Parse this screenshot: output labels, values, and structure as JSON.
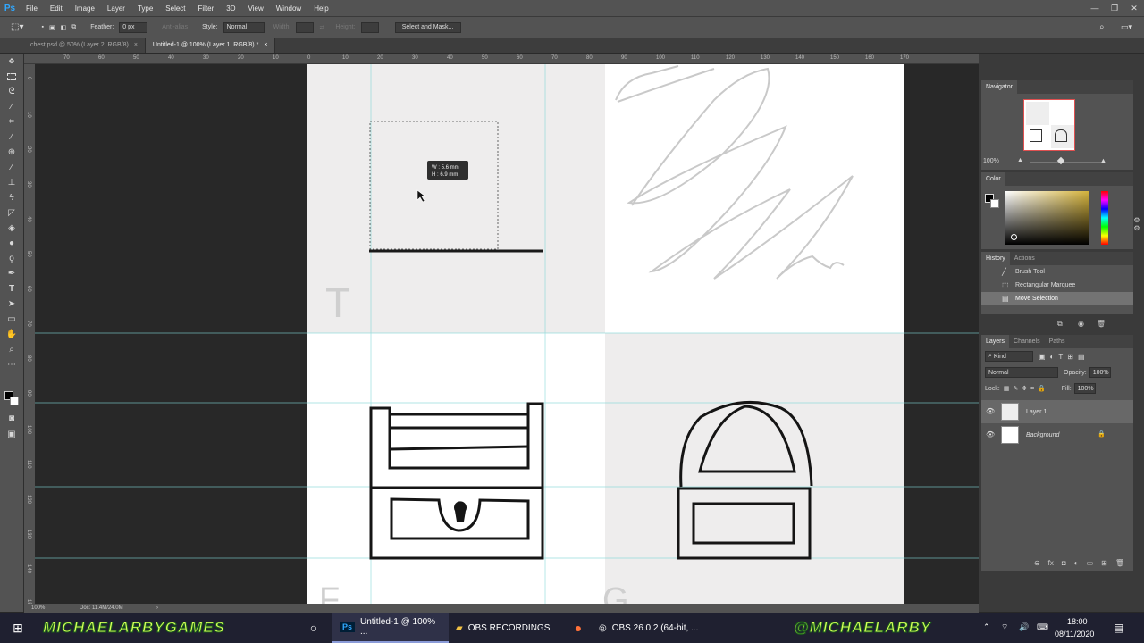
{
  "app": {
    "logo": "Ps",
    "window_controls": [
      "—",
      "❐",
      "✕"
    ]
  },
  "menu": [
    "File",
    "Edit",
    "Image",
    "Layer",
    "Type",
    "Select",
    "Filter",
    "3D",
    "View",
    "Window",
    "Help"
  ],
  "options": {
    "feather_label": "Feather:",
    "feather_value": "0 px",
    "antialias_label": "Anti-alias",
    "style_label": "Style:",
    "style_value": "Normal",
    "width_label": "Width:",
    "height_label": "Height:",
    "select_mask_label": "Select and Mask..."
  },
  "doc_tabs": [
    {
      "label": "chest.psd @ 50% (Layer 2, RGB/8)"
    },
    {
      "label": "Untitled-1 @ 100% (Layer 1, RGB/8) *"
    }
  ],
  "ruler_top": [
    "70",
    "60",
    "50",
    "40",
    "30",
    "20",
    "10",
    "0",
    "10",
    "20",
    "30",
    "40",
    "50",
    "60",
    "70",
    "80",
    "90",
    "100",
    "110",
    "120",
    "130",
    "140",
    "150",
    "160",
    "170"
  ],
  "ruler_left": [
    "0",
    "10",
    "20",
    "30",
    "40",
    "50",
    "60",
    "70",
    "80",
    "90",
    "100",
    "110",
    "120",
    "130",
    "140",
    "150",
    "160"
  ],
  "canvas": {
    "tooltip_w": "W : 5.6 mm",
    "tooltip_h": "H : 6.9 mm",
    "letters": [
      "T",
      "F",
      "G"
    ]
  },
  "status": {
    "zoom": "100%",
    "doc": "Doc: 11.4M/24.0M",
    "arrow": "›"
  },
  "navigator": {
    "title": "Navigator",
    "zoom": "100%"
  },
  "color_panel": {
    "title": "Color",
    "accent": "#d4b23a"
  },
  "history": {
    "tabs": [
      "History",
      "Actions"
    ],
    "items": [
      {
        "label": "Brush Tool",
        "icon": "brush-icon",
        "glyph": "╱"
      },
      {
        "label": "Rectangular Marquee",
        "icon": "marquee-icon",
        "glyph": "⬚"
      },
      {
        "label": "Move Selection",
        "icon": "move-icon",
        "glyph": "▤"
      }
    ]
  },
  "layers": {
    "tabs": [
      "Layers",
      "Channels",
      "Paths"
    ],
    "kind_label": "Kind",
    "blend_mode": "Normal",
    "opacity_label": "Opacity:",
    "opacity_value": "100%",
    "lock_label": "Lock:",
    "fill_label": "Fill:",
    "fill_value": "100%",
    "items": [
      {
        "name": "Layer 1"
      },
      {
        "name": "Background"
      }
    ],
    "footer_icons": [
      "⊖",
      "fx",
      "◘",
      "◐",
      "▭",
      "⊞",
      "🗑"
    ]
  },
  "taskbar": {
    "banner_left": "MICHAELARBYGAMES",
    "banner_right": "@MICHAELARBY",
    "apps": [
      {
        "label": "Untitled-1 @ 100% ..."
      },
      {
        "label": "OBS RECORDINGS"
      },
      {
        "label": "OBS 26.0.2 (64-bit, ..."
      }
    ],
    "time": "18:00",
    "date": "08/11/2020"
  }
}
